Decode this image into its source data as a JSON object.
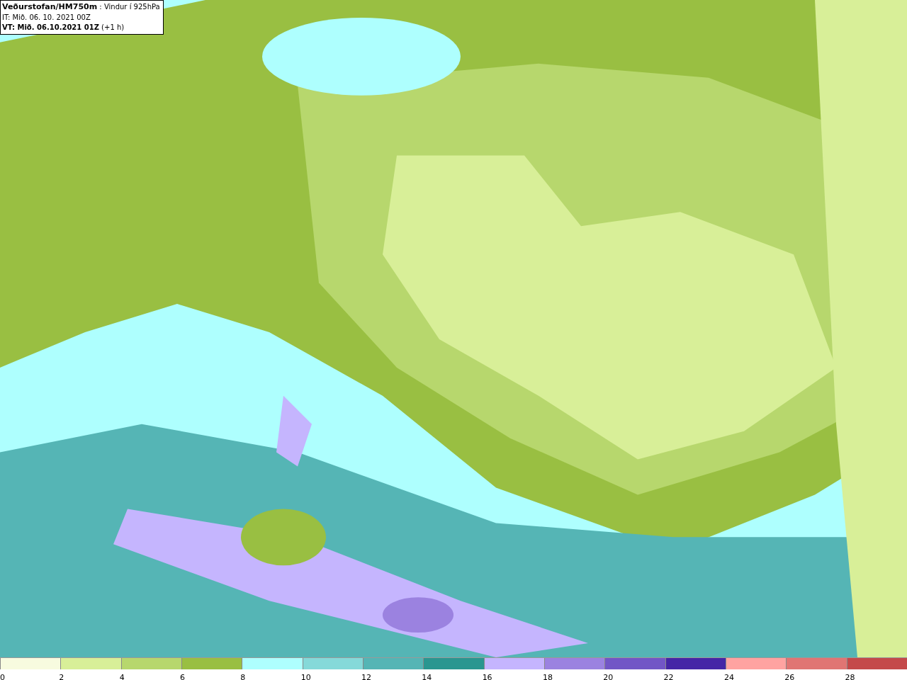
{
  "header": {
    "title": "**Veðurstofan/HM750m** : Vindur í 925hPa",
    "issue_time": "IT: Mið. 06. 10. 2021 00Z",
    "valid_time": "**VT: Mið. 06.10.2021 01Z** (+1 h)"
  },
  "legend": {
    "bins": [
      {
        "color": "#f7fbdf",
        "label": "0"
      },
      {
        "color": "#d8ef98",
        "label": "2"
      },
      {
        "color": "#b7d76d",
        "label": "4"
      },
      {
        "color": "#99bf42",
        "label": "6"
      },
      {
        "color": "#aefffe",
        "label": "8"
      },
      {
        "color": "#85d9d9",
        "label": "10"
      },
      {
        "color": "#55b5b5",
        "label": "12"
      },
      {
        "color": "#2a9690",
        "label": "14"
      },
      {
        "color": "#c5b5fe",
        "label": "16"
      },
      {
        "color": "#9b82e0",
        "label": "18"
      },
      {
        "color": "#7256c6",
        "label": "20"
      },
      {
        "color": "#4526a6",
        "label": "22"
      },
      {
        "color": "#ffa3a1",
        "label": "24"
      },
      {
        "color": "#e07573",
        "label": "26"
      },
      {
        "color": "#c4494a",
        "label": "28"
      }
    ]
  }
}
